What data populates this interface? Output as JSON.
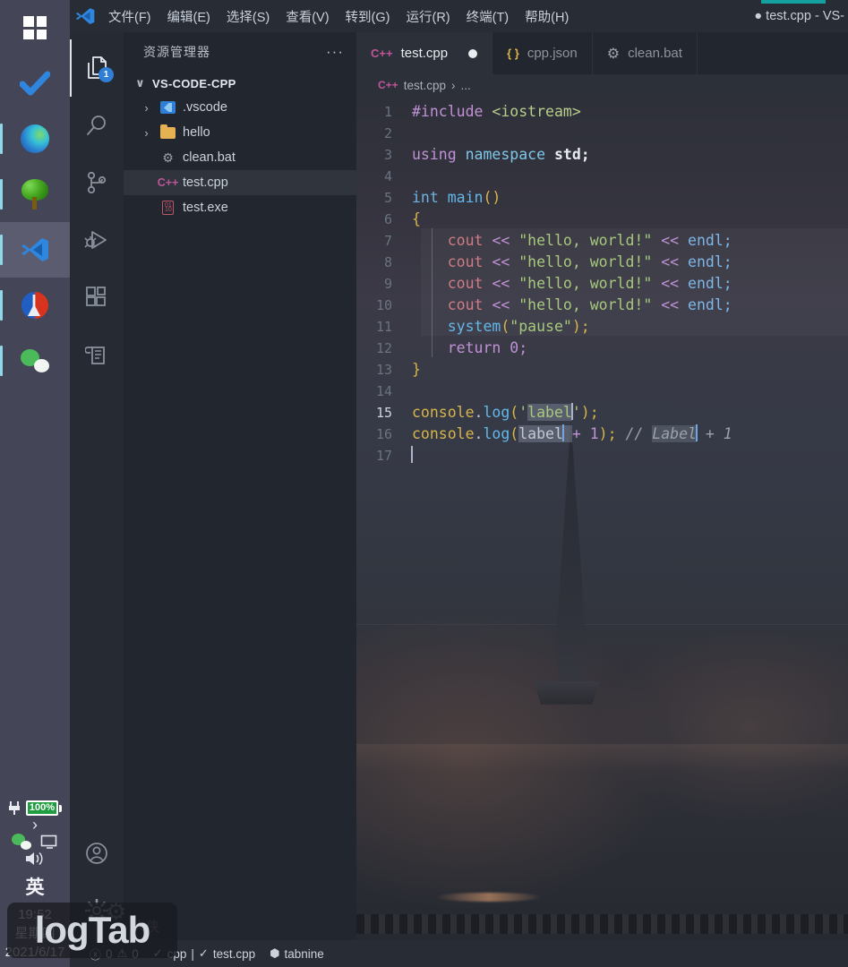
{
  "taskbar": {
    "items": [
      {
        "name": "start-button",
        "icon": "windows-logo-icon",
        "label": "开始",
        "active": false,
        "running": false
      },
      {
        "name": "todo-app",
        "icon": "checkmark-icon",
        "label": "Todo",
        "active": false,
        "running": false
      },
      {
        "name": "edge-browser",
        "icon": "edge-icon",
        "label": "Microsoft Edge",
        "active": false,
        "running": true
      },
      {
        "name": "tree-app",
        "icon": "tree-icon",
        "label": "Tree App",
        "active": false,
        "running": true
      },
      {
        "name": "vscode-app",
        "icon": "vscode-icon",
        "label": "Visual Studio Code",
        "active": true,
        "running": true
      },
      {
        "name": "tool-app",
        "icon": "wrench-icon",
        "label": "Tool",
        "active": false,
        "running": true
      },
      {
        "name": "wechat-app",
        "icon": "wechat-icon",
        "label": "WeChat",
        "active": false,
        "running": true
      }
    ],
    "tray": {
      "battery_percent": "100%",
      "chevron": "›",
      "wechat_icon": "wechat-tray-icon",
      "display_icon": "display-icon",
      "volume_icon": "volume-icon",
      "ime": "英",
      "time": "19:52",
      "weekday": "星期四",
      "date": "2021/6/17"
    }
  },
  "titlebar": {
    "menus": [
      "文件(F)",
      "编辑(E)",
      "选择(S)",
      "查看(V)",
      "转到(G)",
      "运行(R)",
      "终端(T)",
      "帮助(H)"
    ],
    "window_title": "● test.cpp - VS-",
    "accent_color": "#15a0a0"
  },
  "activitybar": {
    "items": [
      {
        "name": "explorer",
        "icon": "files-icon",
        "active": true,
        "badge": "1"
      },
      {
        "name": "search",
        "icon": "search-icon",
        "active": false,
        "badge": ""
      },
      {
        "name": "source-control",
        "icon": "source-control-icon",
        "active": false,
        "badge": ""
      },
      {
        "name": "run-and-debug",
        "icon": "run-debug-icon",
        "active": false,
        "badge": ""
      },
      {
        "name": "extensions",
        "icon": "extensions-icon",
        "active": false,
        "badge": ""
      },
      {
        "name": "todo-tree",
        "icon": "todo-tree-icon",
        "active": false,
        "badge": ""
      }
    ],
    "bottom": [
      {
        "name": "accounts",
        "icon": "account-icon"
      },
      {
        "name": "manage-settings",
        "icon": "gear-icon"
      }
    ]
  },
  "sidebar": {
    "title": "资源管理器",
    "more_actions": "···",
    "root_folder": "VS-CODE-CPP",
    "root_twisty": "∨",
    "files": [
      {
        "label": ".vscode",
        "icon": "vscode-folder-icon",
        "twisty": "›",
        "indent": 0,
        "selected": false
      },
      {
        "label": "hello",
        "icon": "folder-icon",
        "twisty": "›",
        "indent": 0,
        "selected": false
      },
      {
        "label": "clean.bat",
        "icon": "gear-file-icon",
        "twisty": "",
        "indent": 0,
        "selected": false
      },
      {
        "label": "test.cpp",
        "icon": "cpp-file-icon",
        "twisty": "",
        "indent": 0,
        "selected": true
      },
      {
        "label": "test.exe",
        "icon": "exe-file-icon",
        "twisty": "",
        "indent": 0,
        "selected": false
      }
    ]
  },
  "editor": {
    "tabs": [
      {
        "label": "test.cpp",
        "icon": "cpp-file-icon",
        "icon_glyph": "C++",
        "active": true,
        "dirty": true
      },
      {
        "label": "cpp.json",
        "icon": "json-file-icon",
        "icon_glyph": "{ }",
        "active": false,
        "dirty": false
      },
      {
        "label": "clean.bat",
        "icon": "gear-file-icon",
        "icon_glyph": "⚙",
        "active": false,
        "dirty": false
      }
    ],
    "breadcrumb": {
      "file_icon_glyph": "C++",
      "file": "test.cpp",
      "separator": "›",
      "rest": "..."
    },
    "language": "cpp",
    "lines": [
      {
        "n": "1",
        "current": false
      },
      {
        "n": "2",
        "current": false
      },
      {
        "n": "3",
        "current": false
      },
      {
        "n": "4",
        "current": false
      },
      {
        "n": "5",
        "current": false
      },
      {
        "n": "6",
        "current": false
      },
      {
        "n": "7",
        "current": false
      },
      {
        "n": "8",
        "current": false
      },
      {
        "n": "9",
        "current": false
      },
      {
        "n": "10",
        "current": false
      },
      {
        "n": "11",
        "current": false
      },
      {
        "n": "12",
        "current": false
      },
      {
        "n": "13",
        "current": false
      },
      {
        "n": "14",
        "current": false
      },
      {
        "n": "15",
        "current": true
      },
      {
        "n": "16",
        "current": false
      },
      {
        "n": "17",
        "current": false
      }
    ],
    "code_text": {
      "l1_include": "#include",
      "l1_header": "<iostream>",
      "l3_using": "using",
      "l3_namespace": "namespace",
      "l3_std": "std;",
      "l5_int": "int",
      "l5_main": "main",
      "l5_parens": "()",
      "l6_brace": "{",
      "l7_cout": "cout",
      "l7_op": "<<",
      "l7_str": "\"hello, world!\"",
      "l7_endl": "endl;",
      "l11_system": "system",
      "l11_lparen": "(",
      "l11_str": "\"pause\"",
      "l11_rparen": ");",
      "l12_return": "return",
      "l12_zero": "0;",
      "l13_brace": "}",
      "l15_obj": "console",
      "l15_dot": ".",
      "l15_log": "log",
      "l15_lparen": "(",
      "l15_quote1": "'",
      "l15_label": "label",
      "l15_quote2": "'",
      "l15_rparen": ");",
      "l16_obj": "console",
      "l16_dot": ".",
      "l16_log": "log",
      "l16_lparen": "(",
      "l16_label": "label",
      "l16_plus": "+",
      "l16_one": "1",
      "l16_rparen": ");",
      "l16_comment_slashes": "//",
      "l16_comment_label": "Label",
      "l16_comment_rest": "+ 1"
    }
  },
  "statusbar": {
    "error_icon": "error-circle-icon",
    "error_count": "0",
    "warning_icon": "warning-triangle-icon",
    "warning_count": "0",
    "cpp_check_icon": "check-icon",
    "cpp_label": "cpp",
    "divider": "|",
    "file_check_icon": "check-icon",
    "file_label": "test.cpp",
    "tabnine_icon": "tabnine-icon",
    "tabnine_label": "tabnine"
  },
  "overlay": {
    "watermark": "logTab",
    "watermark_cn": "大侠"
  }
}
